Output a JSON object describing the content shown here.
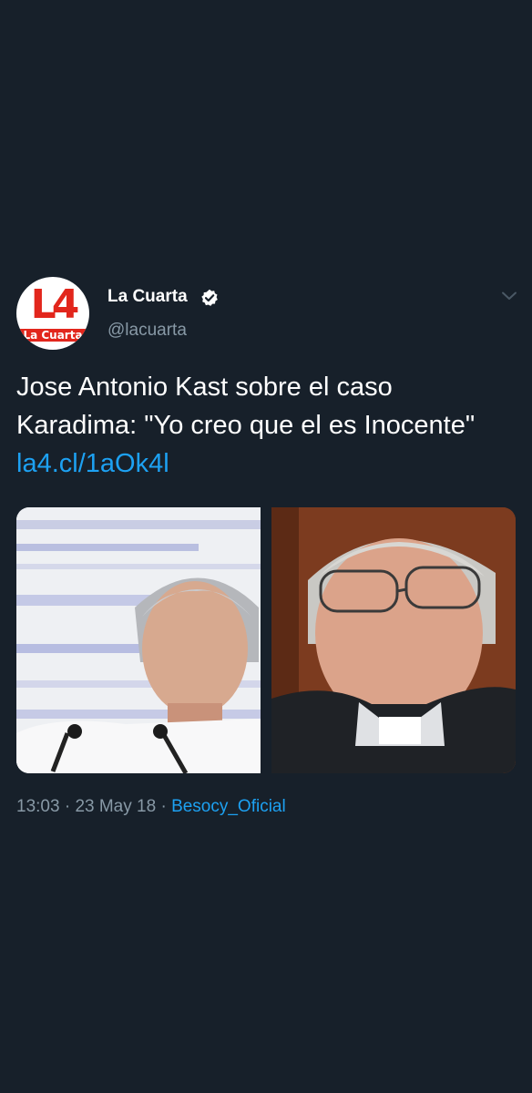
{
  "tweet": {
    "avatar": {
      "logo_main": "L4",
      "logo_sub": "La Cuarta"
    },
    "author_name": "La Cuarta",
    "author_handle": "@lacuarta",
    "text": "Jose Antonio Kast sobre el caso Karadima: \"Yo creo que el es Inocente\"",
    "link": "la4.cl/1aOk4l",
    "media": [
      {
        "name": "photo-left",
        "icon": "person-photo"
      },
      {
        "name": "photo-right",
        "icon": "person-photo"
      }
    ],
    "time": "13:03",
    "date": "23 May 18",
    "separator": "·",
    "source": "Besocy_Oficial"
  },
  "icons": {
    "verified": "verified-badge-icon",
    "caret": "chevron-down-icon"
  },
  "colors": {
    "background": "#17202a",
    "link": "#1da1f2",
    "secondary_text": "#8899a6",
    "brand_red": "#e2261c"
  }
}
